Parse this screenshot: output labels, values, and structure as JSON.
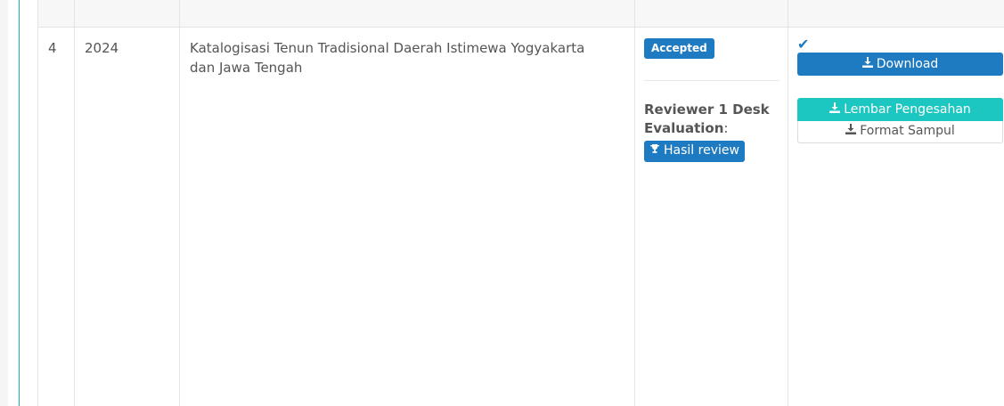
{
  "row": {
    "number": "4",
    "year": "2024",
    "title_line1": "Katalogisasi Tenun Tradisional Daerah Istimewa Yogyakarta",
    "title_line2": "dan Jawa Tengah",
    "status_badge": "Accepted",
    "reviewer_label": "Reviewer 1 Desk Evaluation",
    "reviewer_suffix": ":",
    "hasil_review_label": "Hasil review",
    "download_label": "Download",
    "lembar_label": "Lembar Pengesahan",
    "format_label": "Format Sampul"
  },
  "icons": {
    "check": "check-icon",
    "download": "download-icon",
    "trophy": "trophy-icon"
  },
  "colors": {
    "primary": "#1f7bc1",
    "info": "#1cc7c1",
    "accent_bar": "#1fb5ad"
  }
}
